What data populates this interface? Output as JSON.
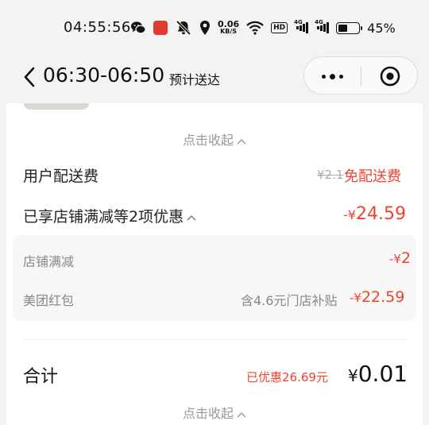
{
  "status_bar": {
    "time": "04:55:56",
    "net_speed_value": "0.06",
    "net_speed_unit": "KB/S",
    "hd_label": "HD",
    "signal_1_type": "4G",
    "signal_2_type": "4G",
    "battery_percent": "45%",
    "battery_level": 0.45
  },
  "nav": {
    "title": "06:30-06:50",
    "subtitle": "预计送达"
  },
  "order": {
    "collapse_label": "点击收起",
    "delivery_fee_label": "用户配送费",
    "delivery_fee_original": "¥2.1",
    "delivery_fee_free": "免配送费",
    "discount_summary_label": "已享店铺满减等2项优惠",
    "discount_total_prefix": "-",
    "discount_total_yen": "¥",
    "discount_total_value": "24.59",
    "store_discount_label": "店铺满减",
    "store_discount_prefix": "-",
    "store_discount_yen": "¥",
    "store_discount_value": "2",
    "red_packet_label": "美团红包",
    "red_packet_note": "含4.6元门店补贴",
    "red_packet_prefix": "-",
    "red_packet_yen": "¥",
    "red_packet_value": "22.59",
    "total_label": "合计",
    "saved_text": "已优惠26.69元",
    "total_yen": "¥",
    "total_value": "0.01",
    "bottom_collapse_label": "点击收起"
  },
  "colors": {
    "accent_red": "#f0432f",
    "page_bg": "#f3f3f3",
    "card_bg": "#ffffff",
    "muted_text": "#999999"
  }
}
